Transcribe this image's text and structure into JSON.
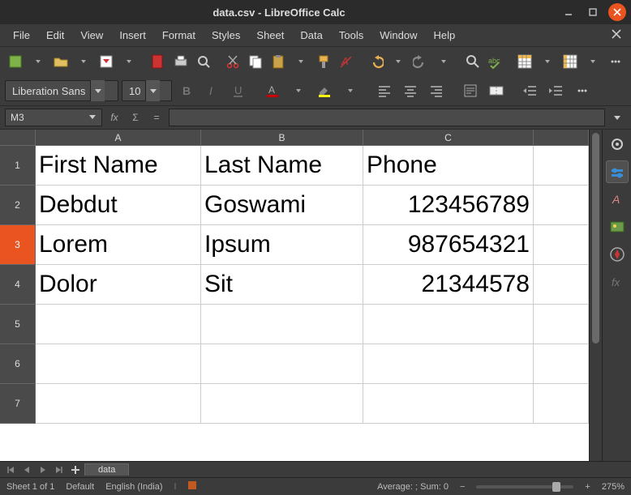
{
  "window": {
    "title": "data.csv - LibreOffice Calc"
  },
  "menu": {
    "file": "File",
    "edit": "Edit",
    "view": "View",
    "insert": "Insert",
    "format": "Format",
    "styles": "Styles",
    "sheet": "Sheet",
    "data": "Data",
    "tools": "Tools",
    "window": "Window",
    "help": "Help"
  },
  "formatting": {
    "font_name": "Liberation Sans",
    "font_size": "10"
  },
  "formulabar": {
    "cell_ref": "M3",
    "fx_label": "fx",
    "sigma_label": "Σ",
    "eq_label": "="
  },
  "columns": {
    "A": "A",
    "B": "B",
    "C": "C"
  },
  "col_widths": {
    "A": 204,
    "B": 200,
    "C": 210,
    "rest": 30
  },
  "rows": {
    "1": "1",
    "2": "2",
    "3": "3",
    "4": "4",
    "5": "5",
    "6": "6",
    "7": "7"
  },
  "selected_row": "3",
  "cells": {
    "A1": "First Name",
    "B1": "Last Name",
    "C1": "Phone",
    "A2": "Debdut",
    "B2": "Goswami",
    "C2": "123456789",
    "A3": "Lorem",
    "B3": "Ipsum",
    "C3": "987654321",
    "A4": "Dolor",
    "B4": "Sit",
    "C4": "21344578"
  },
  "tabs": {
    "sheet1": "data"
  },
  "status": {
    "sheet": "Sheet 1 of 1",
    "style": "Default",
    "lang": "English (India)",
    "calc": "Average: ; Sum: 0",
    "zoom": "275%"
  }
}
